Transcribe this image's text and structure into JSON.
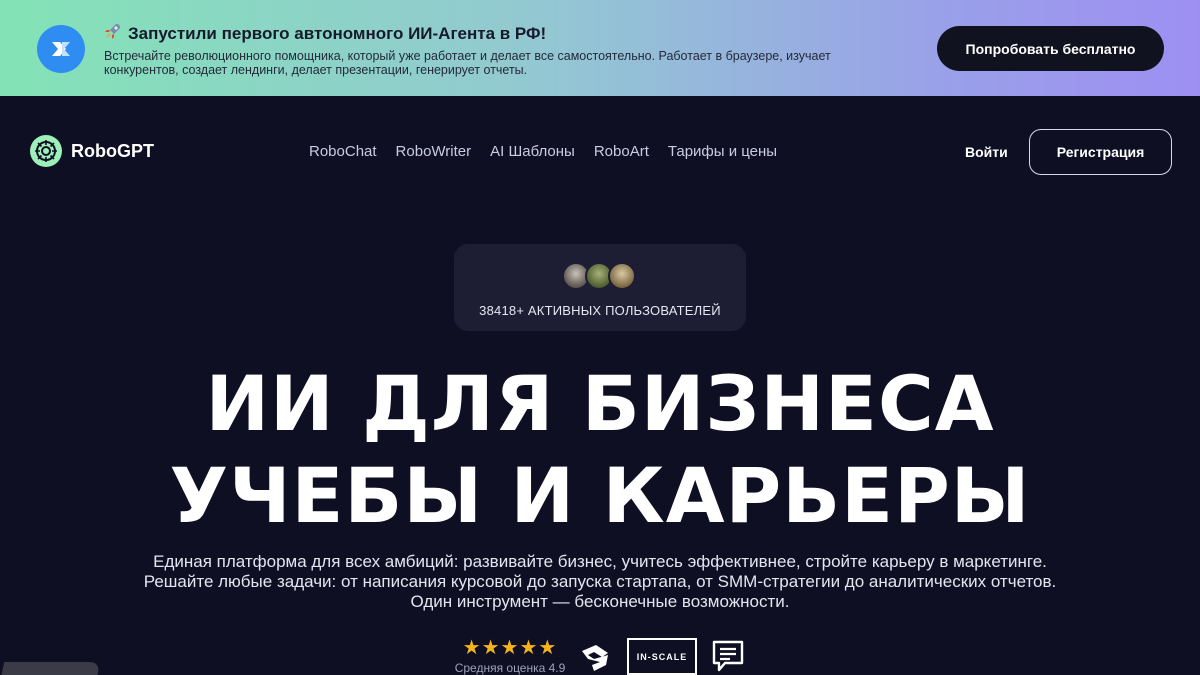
{
  "banner": {
    "title": "Запустили первого автономного ИИ-Агента в РФ!",
    "description": "Встречайте революционного помощника, который уже работает и делает все самостоятельно. Работает в браузере, изучает конкурентов, создает лендинги, делает презентации, генерирует отчеты.",
    "cta": "Попробовать бесплатно",
    "icon": "rocket-icon",
    "logo_icon": "agent-logo-icon"
  },
  "nav": {
    "brand": "RoboGPT",
    "items": [
      "RoboChat",
      "RoboWriter",
      "AI Шаблоны",
      "RoboArt",
      "Тарифы и цены"
    ],
    "login": "Войти",
    "register": "Регистрация"
  },
  "hero": {
    "users_count": "38418+ АКТИВНЫХ ПОЛЬЗОВАТЕЛЕЙ",
    "title_line1": "ИИ ДЛЯ БИЗНЕСА",
    "title_line2": "УЧЕБЫ И КАРЬЕРЫ",
    "description": "Единая платформа для всех амбиций: развивайте бизнес, учитесь эффективнее, стройте карьеру в маркетинге. Решайте любые задачи: от написания курсовой до запуска стартапа, от SMM-стратегии до аналитических отчетов. Один инструмент — бесконечные возможности.",
    "rating": {
      "stars": "★★★★★",
      "label": "Средняя оценка 4.9",
      "value": 4.9
    },
    "partners": {
      "inscale": "IN-SCALE"
    }
  },
  "colors": {
    "background": "#0f0f24",
    "banner_start": "#83e3b6",
    "banner_end": "#9d8ff2",
    "star": "#f5b31c",
    "brand_logo": "#9cf0b8"
  }
}
